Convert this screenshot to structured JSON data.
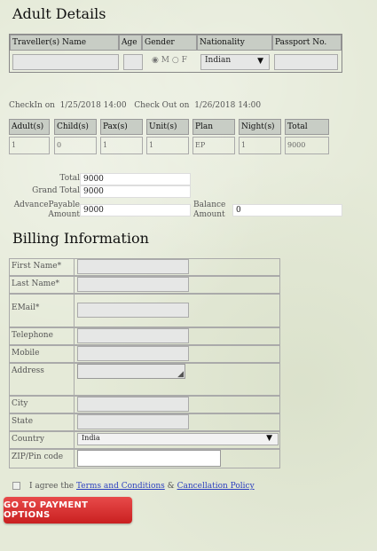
{
  "adult_details": {
    "title": "Adult Details",
    "headers": [
      "Traveller(s) Name",
      "Age",
      "Gender",
      "Nationality",
      "Passport No."
    ],
    "gender_male": "M",
    "gender_female": "F",
    "nationality_selected": "Indian"
  },
  "stay": {
    "checkin_label": "CheckIn on",
    "checkin_value": "1/25/2018 14:00",
    "checkout_label": "Check Out on",
    "checkout_value": "1/26/2018 14:00"
  },
  "summary": {
    "headers": [
      "Adult(s)",
      "Child(s)",
      "Pax(s)",
      "Unit(s)",
      "Plan",
      "Night(s)",
      "Total"
    ],
    "values": [
      "1",
      "0",
      "1",
      "1",
      "EP",
      "1",
      "9000"
    ]
  },
  "totals": {
    "total_label": "Total",
    "total_value": "9000",
    "grand_total_label": "Grand Total",
    "grand_total_value": "9000",
    "advance_label_1": "AdvancePayable",
    "advance_label_2": "Amount",
    "advance_value": "9000",
    "balance_label_1": "Balance",
    "balance_label_2": "Amount",
    "balance_value": "0"
  },
  "billing": {
    "title": "Billing Information",
    "first_name_label": "First Name*",
    "last_name_label": "Last Name*",
    "email_label": "EMail*",
    "telephone_label": "Telephone",
    "mobile_label": "Mobile",
    "address_label": "Address",
    "city_label": "City",
    "state_label": "State",
    "country_label": "Country",
    "country_value": "India",
    "zip_label": "ZIP/Pin code"
  },
  "agreement": {
    "prefix": "I agree the",
    "terms_link": "Terms and Conditions",
    "amp": "&",
    "policy_link": "Cancellation Policy"
  },
  "payment_button": "GO TO PAYMENT OPTIONS"
}
